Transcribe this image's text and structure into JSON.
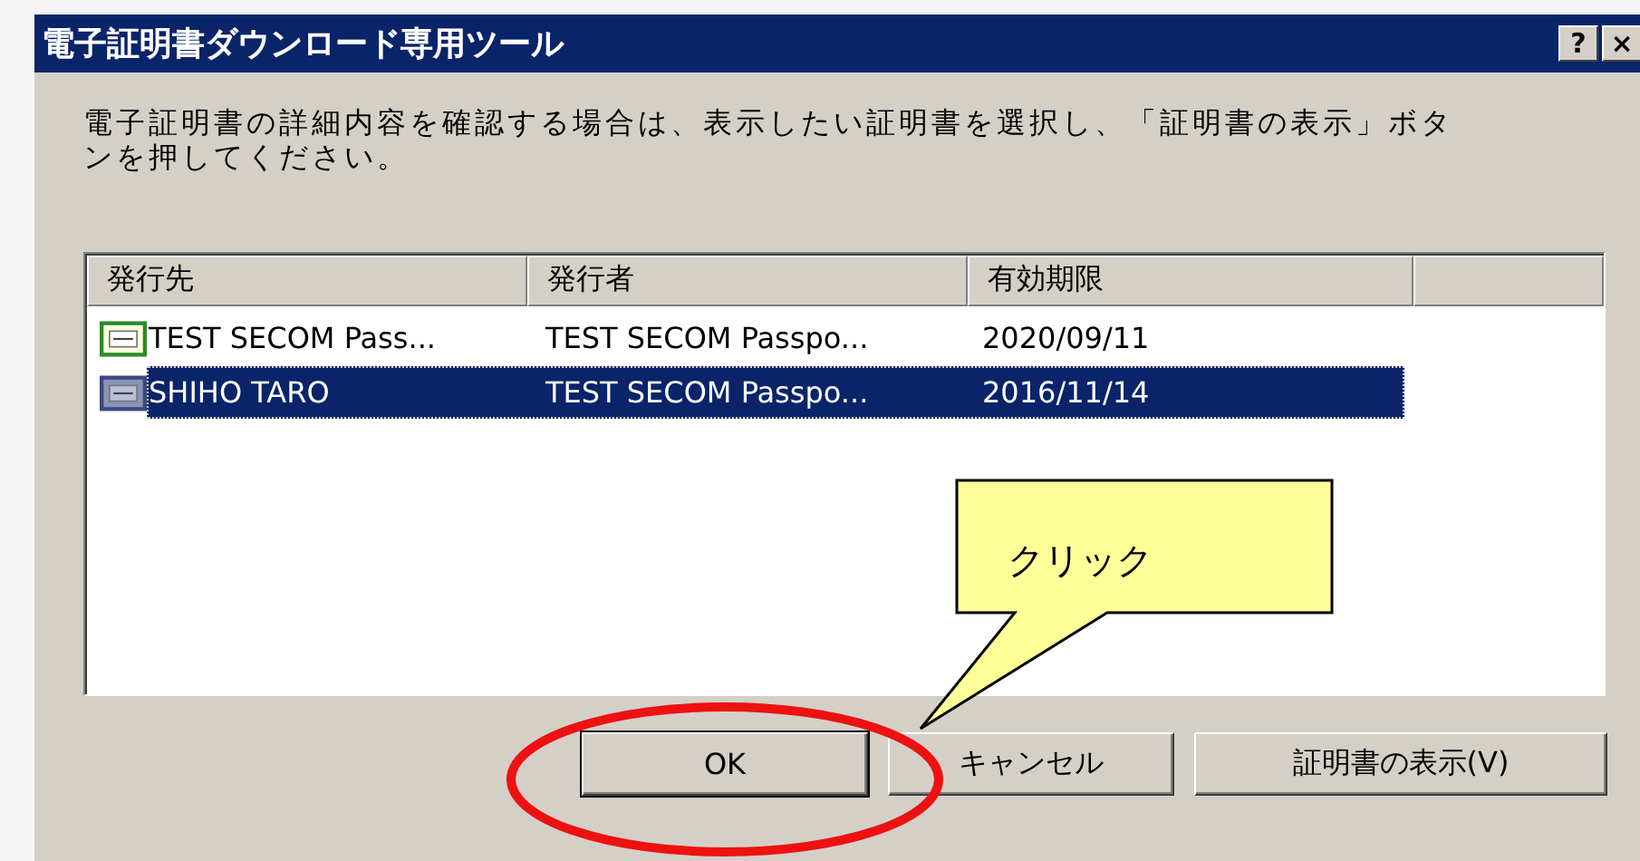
{
  "window": {
    "title": "電子証明書ダウンロード専用ツール",
    "controls": [
      "?",
      "×"
    ]
  },
  "instruction": "電子証明書の詳細内容を確認する場合は、表示したい証明書を選択し、「証明書の表示」ボタンを押してください。",
  "table": {
    "columns": [
      "発行先",
      "発行者",
      "有効期限"
    ],
    "rows": [
      {
        "cells": [
          "TEST SECOM Pass...",
          "TEST SECOM Passpo...",
          "2020/09/11"
        ],
        "selected": false
      },
      {
        "cells": [
          "SHIHO TARO",
          "TEST SECOM Passpo...",
          "2016/11/14"
        ],
        "selected": true
      }
    ]
  },
  "buttons": [
    {
      "label": "OK",
      "default": true
    },
    {
      "label": "キャンセル",
      "default": false
    },
    {
      "label": "証明書の表示(V)",
      "default": false
    }
  ],
  "callout": {
    "text": "クリック"
  }
}
